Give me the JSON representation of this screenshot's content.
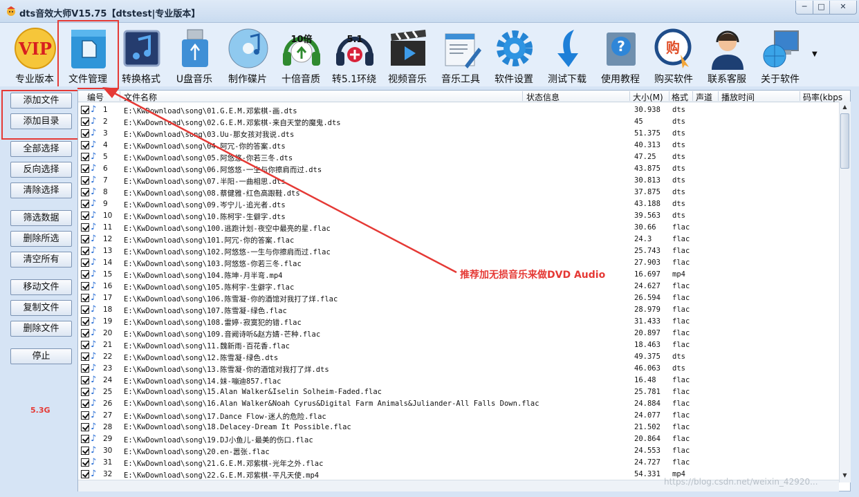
{
  "window": {
    "title": "dts音效大师V15.75【dtstest|专业版本】"
  },
  "toolbar": {
    "items": [
      {
        "label": "专业版本",
        "icon": "vip-badge-icon"
      },
      {
        "label": "文件管理",
        "icon": "file-folder-icon"
      },
      {
        "label": "转换格式",
        "icon": "music-note-icon"
      },
      {
        "label": "U盘音乐",
        "icon": "usb-drive-icon"
      },
      {
        "label": "制作碟片",
        "icon": "disc-icon"
      },
      {
        "label": "十倍音质",
        "icon": "headphones-10x-icon"
      },
      {
        "label": "转5.1环绕",
        "icon": "headphones-51-icon"
      },
      {
        "label": "视频音乐",
        "icon": "video-clapper-icon"
      },
      {
        "label": "音乐工具",
        "icon": "tools-icon"
      },
      {
        "label": "软件设置",
        "icon": "gear-icon"
      },
      {
        "label": "测试下载",
        "icon": "download-arrow-icon"
      },
      {
        "label": "使用教程",
        "icon": "help-icon"
      },
      {
        "label": "购买软件",
        "icon": "buy-icon"
      },
      {
        "label": "联系客服",
        "icon": "support-agent-icon"
      },
      {
        "label": "关于软件",
        "icon": "computer-globe-icon"
      }
    ],
    "vip_text": "VIP",
    "badge_10": "10倍",
    "badge_51": "5.1",
    "buy_text": "购"
  },
  "side": {
    "buttons": [
      "添加文件",
      "添加目录",
      "全部选择",
      "反向选择",
      "清除选择",
      "筛选数据",
      "删除所选",
      "清空所有",
      "移动文件",
      "复制文件",
      "删除文件",
      "停止"
    ],
    "total_size": "5.3G"
  },
  "list": {
    "columns": [
      "编号",
      "文件名称",
      "状态信息",
      "大小(M)",
      "格式",
      "声道",
      "播放时间",
      "码率(kbps"
    ],
    "rows": [
      {
        "num": "1",
        "path": "E:\\KwDownload\\song\\01.G.E.M.邓紫棋-画.dts",
        "size": "30.938",
        "fmt": "dts"
      },
      {
        "num": "2",
        "path": "E:\\KwDownload\\song\\02.G.E.M.邓紫棋-来自天堂的魔鬼.dts",
        "size": "45",
        "fmt": "dts"
      },
      {
        "num": "3",
        "path": "E:\\KwDownload\\song\\03.Uu-那女孩对我说.dts",
        "size": "51.375",
        "fmt": "dts"
      },
      {
        "num": "4",
        "path": "E:\\KwDownload\\song\\04.阿冗-你的答案.dts",
        "size": "40.313",
        "fmt": "dts"
      },
      {
        "num": "5",
        "path": "E:\\KwDownload\\song\\05.阿悠悠-你若三冬.dts",
        "size": "47.25",
        "fmt": "dts"
      },
      {
        "num": "6",
        "path": "E:\\KwDownload\\song\\06.阿悠悠-一生与你擦肩而过.dts",
        "size": "43.875",
        "fmt": "dts"
      },
      {
        "num": "7",
        "path": "E:\\KwDownload\\song\\07.半阳-一曲相思.dts",
        "size": "30.813",
        "fmt": "dts"
      },
      {
        "num": "8",
        "path": "E:\\KwDownload\\song\\08.蔡健雅-红色高跟鞋.dts",
        "size": "37.875",
        "fmt": "dts"
      },
      {
        "num": "9",
        "path": "E:\\KwDownload\\song\\09.岑宁儿-追光者.dts",
        "size": "43.188",
        "fmt": "dts"
      },
      {
        "num": "10",
        "path": "E:\\KwDownload\\song\\10.陈柯宇-生僻字.dts",
        "size": "39.563",
        "fmt": "dts"
      },
      {
        "num": "11",
        "path": "E:\\KwDownload\\song\\100.逃跑计划-夜空中最亮的星.flac",
        "size": "30.66",
        "fmt": "flac"
      },
      {
        "num": "12",
        "path": "E:\\KwDownload\\song\\101.阿冗-你的答案.flac",
        "size": "24.3",
        "fmt": "flac"
      },
      {
        "num": "13",
        "path": "E:\\KwDownload\\song\\102.阿悠悠-一生与你擦肩而过.flac",
        "size": "25.743",
        "fmt": "flac"
      },
      {
        "num": "14",
        "path": "E:\\KwDownload\\song\\103.阿悠悠-你若三冬.flac",
        "size": "27.903",
        "fmt": "flac"
      },
      {
        "num": "15",
        "path": "E:\\KwDownload\\song\\104.陈坤-月半弯.mp4",
        "size": "16.697",
        "fmt": "mp4"
      },
      {
        "num": "16",
        "path": "E:\\KwDownload\\song\\105.陈柯宇-生僻字.flac",
        "size": "24.627",
        "fmt": "flac"
      },
      {
        "num": "17",
        "path": "E:\\KwDownload\\song\\106.陈雪凝-你的酒馆对我打了烊.flac",
        "size": "26.594",
        "fmt": "flac"
      },
      {
        "num": "18",
        "path": "E:\\KwDownload\\song\\107.陈雪凝-绿色.flac",
        "size": "28.979",
        "fmt": "flac"
      },
      {
        "num": "19",
        "path": "E:\\KwDownload\\song\\108.雷婷-寂寞犯的错.flac",
        "size": "31.433",
        "fmt": "flac"
      },
      {
        "num": "20",
        "path": "E:\\KwDownload\\song\\109.音阙诗听&赵方婧-芒种.flac",
        "size": "20.897",
        "fmt": "flac"
      },
      {
        "num": "21",
        "path": "E:\\KwDownload\\song\\11.魏新雨-百花香.flac",
        "size": "18.463",
        "fmt": "flac"
      },
      {
        "num": "22",
        "path": "E:\\KwDownload\\song\\12.陈雪凝-绿色.dts",
        "size": "49.375",
        "fmt": "dts"
      },
      {
        "num": "23",
        "path": "E:\\KwDownload\\song\\13.陈雪凝-你的酒馆对我打了烊.dts",
        "size": "46.063",
        "fmt": "dts"
      },
      {
        "num": "24",
        "path": "E:\\KwDownload\\song\\14.妹-嘣迪857.flac",
        "size": "16.48",
        "fmt": "flac"
      },
      {
        "num": "25",
        "path": "E:\\KwDownload\\song\\15.Alan Walker&Iselin Solheim-Faded.flac",
        "size": "25.781",
        "fmt": "flac"
      },
      {
        "num": "26",
        "path": "E:\\KwDownload\\song\\16.Alan Walker&Noah Cyrus&Digital Farm Animals&Juliander-All Falls Down.flac",
        "size": "24.884",
        "fmt": "flac"
      },
      {
        "num": "27",
        "path": "E:\\KwDownload\\song\\17.Dance Flow-迷人的危险.flac",
        "size": "24.077",
        "fmt": "flac"
      },
      {
        "num": "28",
        "path": "E:\\KwDownload\\song\\18.Delacey-Dream It Possible.flac",
        "size": "21.502",
        "fmt": "flac"
      },
      {
        "num": "29",
        "path": "E:\\KwDownload\\song\\19.DJ小鱼儿-最美的伤口.flac",
        "size": "20.864",
        "fmt": "flac"
      },
      {
        "num": "30",
        "path": "E:\\KwDownload\\song\\20.en-嚣张.flac",
        "size": "24.553",
        "fmt": "flac"
      },
      {
        "num": "31",
        "path": "E:\\KwDownload\\song\\21.G.E.M.邓紫棋-光年之外.flac",
        "size": "24.727",
        "fmt": "flac"
      },
      {
        "num": "32",
        "path": "E:\\KwDownload\\song\\22.G.E.M.邓紫棋-平凡天使.mp4",
        "size": "54.331",
        "fmt": "mp4"
      }
    ]
  },
  "annotation": {
    "text": "推荐加无损音乐来做DVD Audio"
  },
  "watermark": "https://blog.csdn.net/weixin_42920..."
}
